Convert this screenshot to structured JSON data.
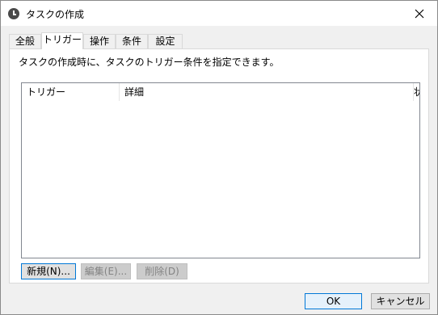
{
  "window": {
    "title": "タスクの作成"
  },
  "tabs": [
    {
      "label": "全般"
    },
    {
      "label": "トリガー"
    },
    {
      "label": "操作"
    },
    {
      "label": "条件"
    },
    {
      "label": "設定"
    }
  ],
  "active_tab": "トリガー",
  "panel": {
    "description": "タスクの作成時に、タスクのトリガー条件を指定できます。"
  },
  "trigger_list": {
    "columns": [
      "トリガー",
      "詳細",
      "状"
    ],
    "rows": []
  },
  "buttons": {
    "new": "新規(N)...",
    "edit": "編集(E)...",
    "delete": "削除(D)",
    "ok": "OK",
    "cancel": "キャンセル"
  }
}
